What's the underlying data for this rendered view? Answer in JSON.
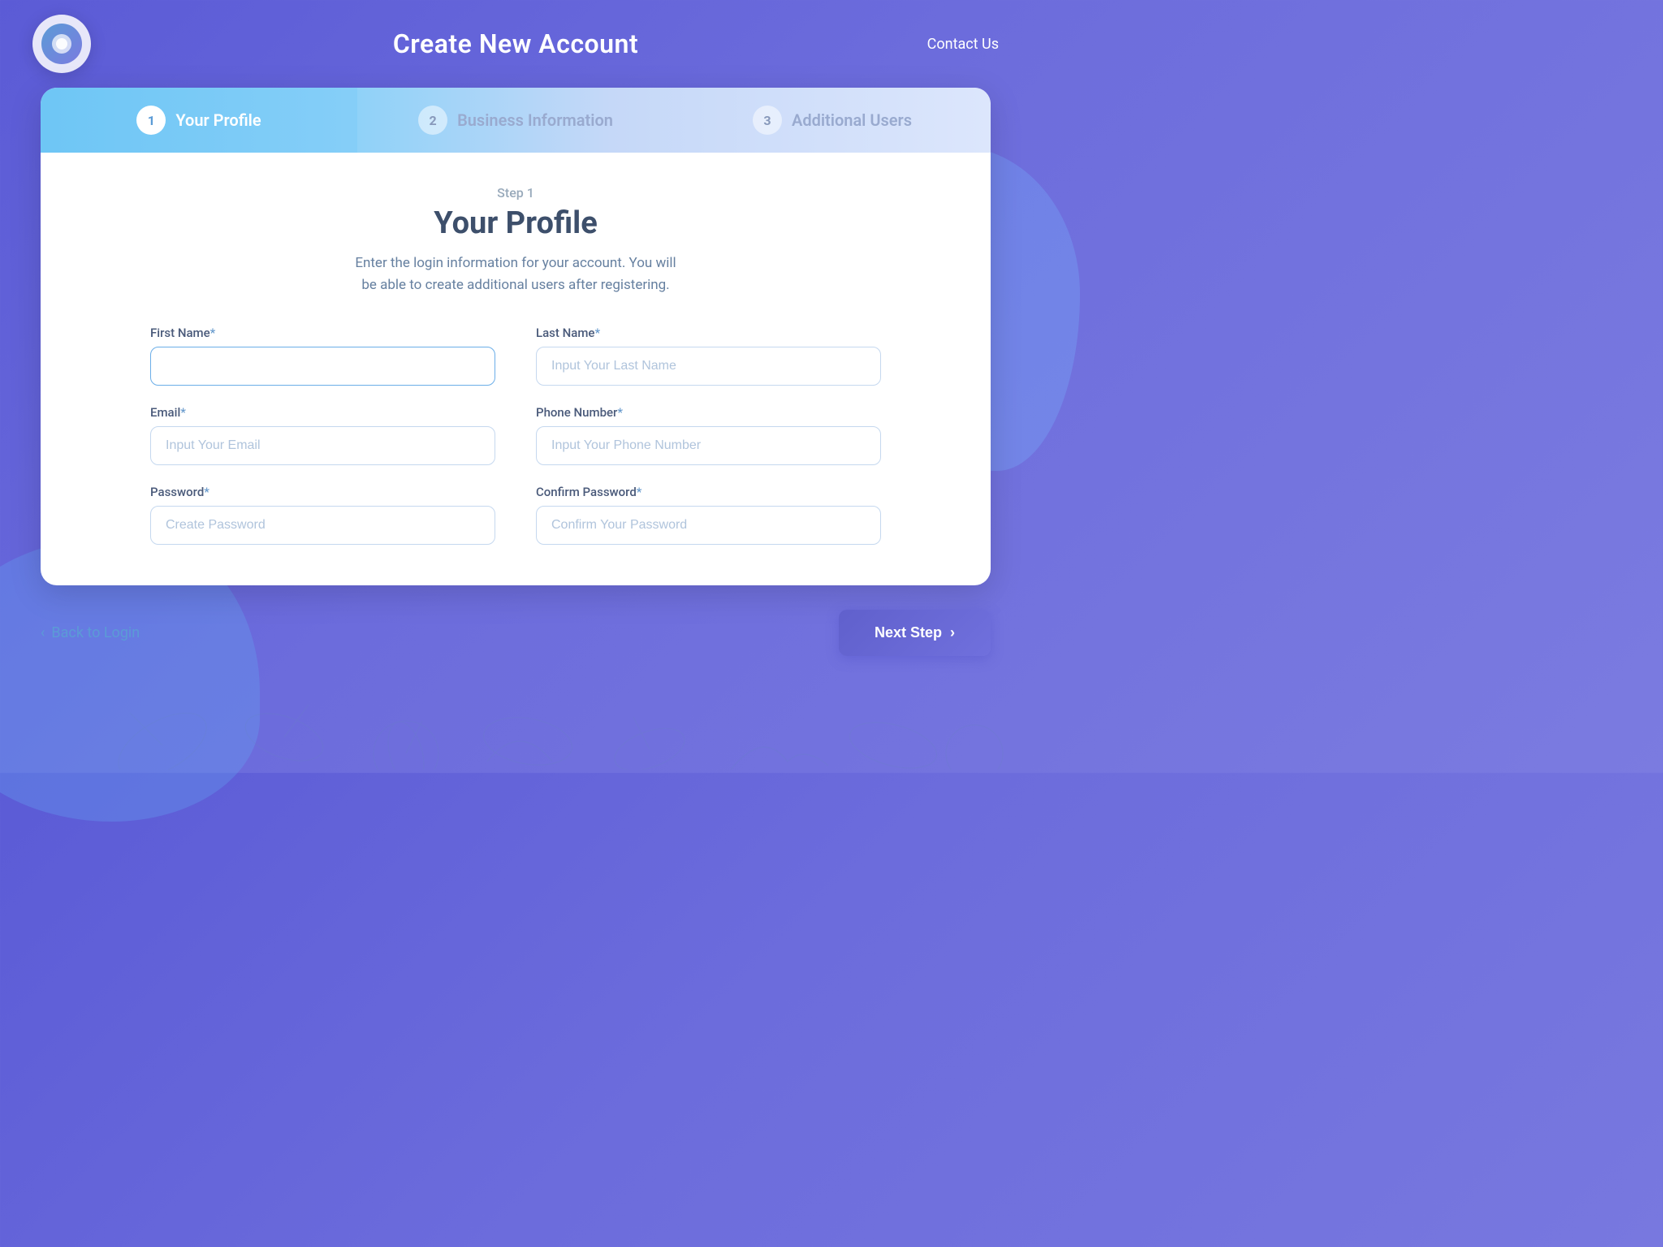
{
  "header": {
    "title": "Create New Account",
    "contact_us_label": "Contact Us"
  },
  "steps": [
    {
      "number": "1",
      "label": "Your Profile",
      "state": "active"
    },
    {
      "number": "2",
      "label": "Business Information",
      "state": "inactive"
    },
    {
      "number": "3",
      "label": "Additional Users",
      "state": "inactive"
    }
  ],
  "form": {
    "step_label": "Step 1",
    "title": "Your Profile",
    "description": "Enter the login information for your account. You will\nbe able to create additional users after registering.",
    "fields": [
      {
        "label": "First Name",
        "required": true,
        "placeholder": "",
        "type": "text",
        "name": "first-name"
      },
      {
        "label": "Last Name",
        "required": true,
        "placeholder": "Input Your Last Name",
        "type": "text",
        "name": "last-name"
      },
      {
        "label": "Email",
        "required": true,
        "placeholder": "Input Your Email",
        "type": "email",
        "name": "email"
      },
      {
        "label": "Phone Number",
        "required": true,
        "placeholder": "Input Your Phone Number",
        "type": "tel",
        "name": "phone-number"
      },
      {
        "label": "Password",
        "required": true,
        "placeholder": "Create Password",
        "type": "password",
        "name": "password"
      },
      {
        "label": "Confirm Password",
        "required": true,
        "placeholder": "Confirm Your Password",
        "type": "password",
        "name": "confirm-password"
      }
    ]
  },
  "footer": {
    "back_label": "Back to Login",
    "next_label": "Next Step"
  }
}
